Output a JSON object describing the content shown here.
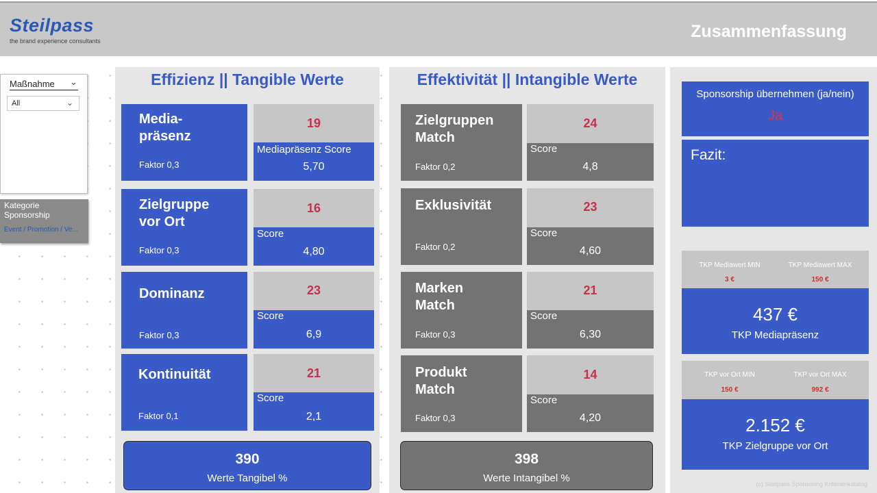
{
  "header": {
    "logo": "Steilpass",
    "logo_tagline": "the brand experience consultants",
    "title": "Zusammenfassung"
  },
  "slicer": {
    "title": "Maßnahme",
    "selected": "All"
  },
  "kategorie": {
    "label": "Kategorie Sponsorship",
    "value": "Event / Promotion / Ve..."
  },
  "tangible": {
    "title": "Effizienz || Tangible Werte",
    "tiles": [
      {
        "name": "Media-\npräsenz",
        "faktor": "Faktor 0,3",
        "score_top": "19",
        "score_label": "Mediapräsenz Score",
        "score_value": "5,70"
      },
      {
        "name": "Zielgruppe\nvor Ort",
        "faktor": "Faktor 0,3",
        "score_top": "16",
        "score_label": "Score",
        "score_value": "4,80"
      },
      {
        "name": "Dominanz",
        "faktor": "Faktor 0,3",
        "score_top": "23",
        "score_label": "Score",
        "score_value": "6,9"
      },
      {
        "name": "Kontinuität",
        "faktor": "Faktor 0,1",
        "score_top": "21",
        "score_label": "Score",
        "score_value": "2,1"
      }
    ],
    "total_value": "390",
    "total_label": "Werte Tangibel %"
  },
  "intangible": {
    "title": "Effektivität || Intangible Werte",
    "tiles": [
      {
        "name": "Zielgruppen\nMatch",
        "faktor": "Faktor 0,2",
        "score_top": "24",
        "score_label": "Score",
        "score_value": "4,8"
      },
      {
        "name": "Exklusivität",
        "faktor": "Faktor 0,2",
        "score_top": "23",
        "score_label": "Score",
        "score_value": "4,60"
      },
      {
        "name": "Marken\nMatch",
        "faktor": "Faktor 0,3",
        "score_top": "21",
        "score_label": "Score",
        "score_value": "6,30"
      },
      {
        "name": "Produkt\nMatch",
        "faktor": "Faktor 0,3",
        "score_top": "14",
        "score_label": "Score",
        "score_value": "4,20"
      }
    ],
    "total_value": "398",
    "total_label": "Werte Intangibel %"
  },
  "summary": {
    "sponsorship_label": "Sponsorship übernehmen (ja/nein)",
    "sponsorship_value": "Ja",
    "fazit_label": "Fazit:",
    "tkp_media": {
      "min_label": "TKP Mediawert MIN",
      "min_value": "3 €",
      "max_label": "TKP Mediawert MAX",
      "max_value": "150 €",
      "value": "437 €",
      "label": "TKP Mediapräsenz"
    },
    "tkp_ort": {
      "min_label": "TKP vor Ort MIN",
      "min_value": "150 €",
      "max_label": "TKP vor Ort MAX",
      "max_value": "992 €",
      "value": "2.152 €",
      "label": "TKP Zielgruppe vor Ort"
    }
  },
  "footer": {
    "copyright": "(c) Steilpass Sponsoring Kriterienkatalog"
  },
  "colors": {
    "accent_blue": "#3a5bc7",
    "tile_gray": "#737373",
    "score_red": "#c7304a",
    "header_gray": "#c8c8c8"
  }
}
